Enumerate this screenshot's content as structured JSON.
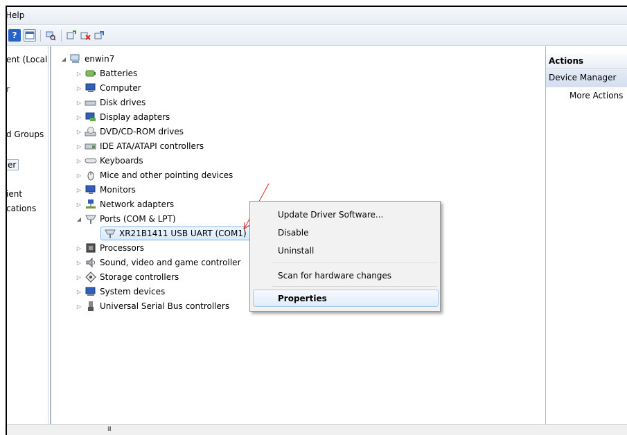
{
  "menubar": {
    "help_label": "Help"
  },
  "toolbar": {
    "icons": [
      "help-icon",
      "console-icon",
      "scan-icon",
      "update-driver-icon",
      "uninstall-icon",
      "enable-icon"
    ]
  },
  "left_pane": {
    "items": [
      "ent (Local",
      "r",
      "d Groups",
      "er",
      "ient",
      "cations"
    ]
  },
  "tree": {
    "root": "enwin7",
    "nodes": [
      {
        "label": "Batteries",
        "icon": "battery-icon"
      },
      {
        "label": "Computer",
        "icon": "computer-icon"
      },
      {
        "label": "Disk drives",
        "icon": "disk-drive-icon"
      },
      {
        "label": "Display adapters",
        "icon": "display-adapter-icon"
      },
      {
        "label": "DVD/CD-ROM drives",
        "icon": "dvd-icon"
      },
      {
        "label": "IDE ATA/ATAPI controllers",
        "icon": "ide-icon"
      },
      {
        "label": "Keyboards",
        "icon": "keyboard-icon"
      },
      {
        "label": "Mice and other pointing devices",
        "icon": "mouse-icon"
      },
      {
        "label": "Monitors",
        "icon": "monitor-icon"
      },
      {
        "label": "Network adapters",
        "icon": "network-icon"
      },
      {
        "label": "Ports (COM & LPT)",
        "icon": "port-icon"
      },
      {
        "label": "XR21B1411 USB UART (COM1)",
        "icon": "port-icon"
      },
      {
        "label": "Processors",
        "icon": "processor-icon"
      },
      {
        "label": "Sound, video and game controller",
        "icon": "sound-icon"
      },
      {
        "label": "Storage controllers",
        "icon": "storage-icon"
      },
      {
        "label": "System devices",
        "icon": "system-icon"
      },
      {
        "label": "Universal Serial Bus controllers",
        "icon": "usb-icon"
      }
    ]
  },
  "context_menu": {
    "items": [
      "Update Driver Software...",
      "Disable",
      "Uninstall",
      "Scan for hardware changes",
      "Properties"
    ]
  },
  "actions_pane": {
    "header": "Actions",
    "section": "Device Manager",
    "more": "More Actions"
  },
  "status": {
    "scroll_grip": "III"
  },
  "colors": {
    "accent": "#2a63c7",
    "annotation_arrow": "#e02020",
    "selection_border": "#7db2e8"
  }
}
